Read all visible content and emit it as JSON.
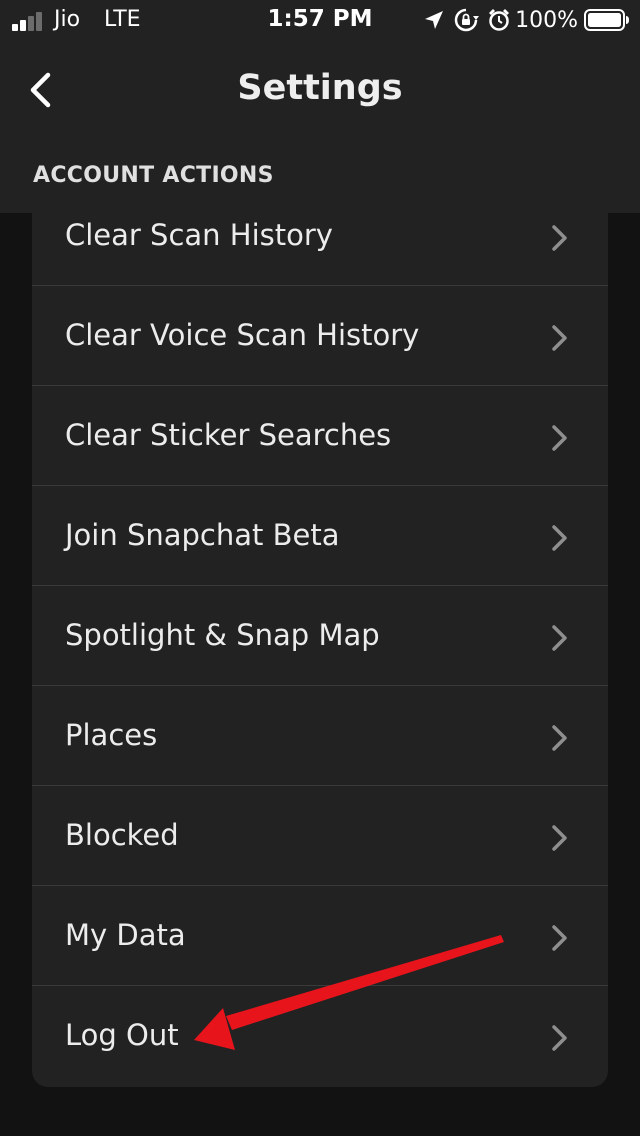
{
  "status_bar": {
    "carrier": "Jio",
    "network": "LTE",
    "time": "1:57 PM",
    "battery_percent": "100%",
    "icons": [
      "signal-bars-icon",
      "location-arrow-icon",
      "rotation-lock-icon",
      "alarm-clock-icon",
      "battery-icon"
    ]
  },
  "nav": {
    "title": "Settings",
    "back_icon": "chevron-left-icon"
  },
  "section": {
    "title": "ACCOUNT ACTIONS"
  },
  "items": [
    {
      "label": "Clear Scan History"
    },
    {
      "label": "Clear Voice Scan History"
    },
    {
      "label": "Clear Sticker Searches"
    },
    {
      "label": "Join Snapchat Beta"
    },
    {
      "label": "Spotlight & Snap Map"
    },
    {
      "label": "Places"
    },
    {
      "label": "Blocked"
    },
    {
      "label": "My Data"
    },
    {
      "label": "Log Out"
    }
  ],
  "colors": {
    "background": "#121212",
    "surface": "#222222",
    "divider": "#3a3a3a",
    "chevron": "#8e8e8e",
    "annotation_arrow": "#e8141c"
  }
}
